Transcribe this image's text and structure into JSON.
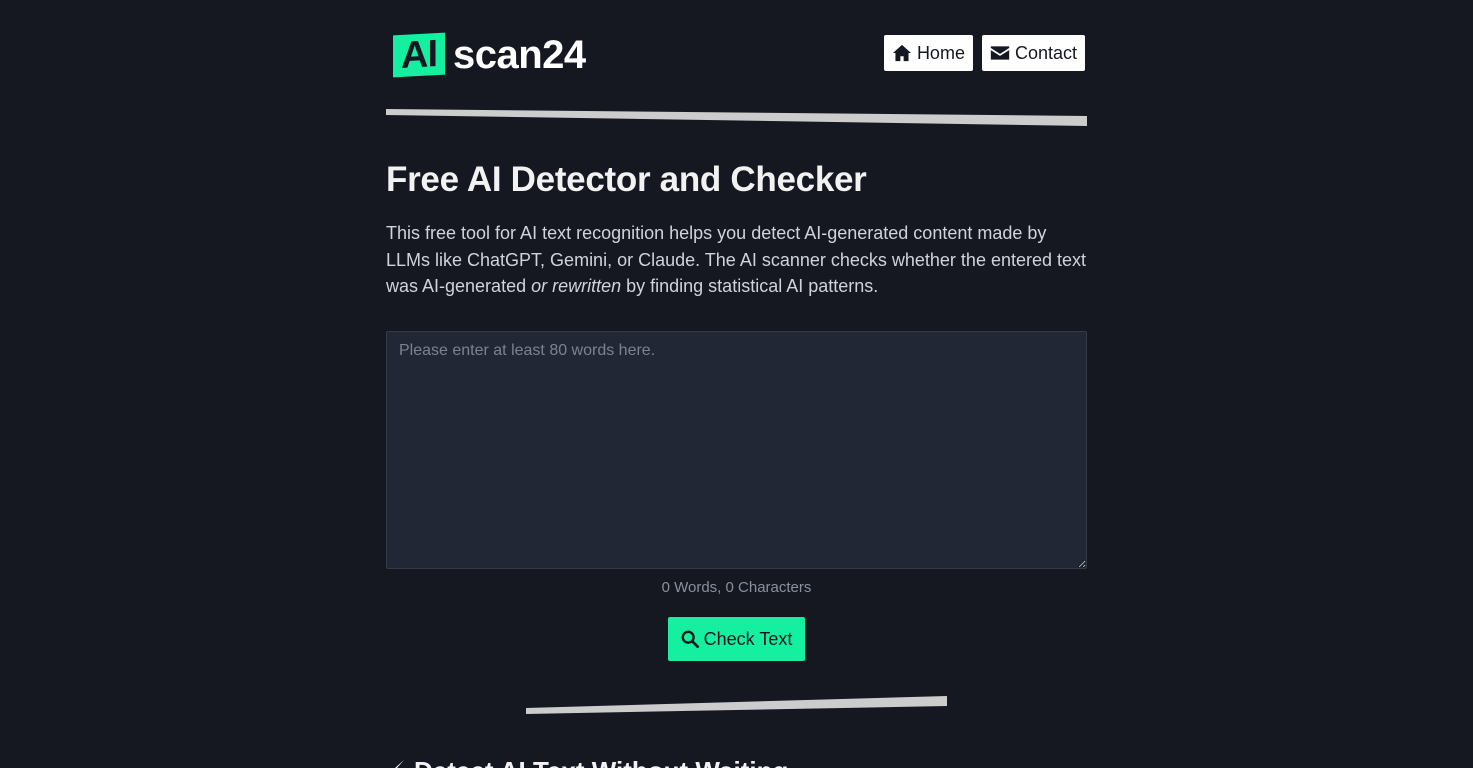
{
  "header": {
    "logo_mark": "AI",
    "logo_text": "scan24",
    "nav": [
      {
        "label": "Home",
        "icon": "home-icon"
      },
      {
        "label": "Contact",
        "icon": "envelope-icon"
      }
    ]
  },
  "main": {
    "title": "Free AI Detector and Checker",
    "intro_part1": "This free tool for AI text recognition helps you detect AI-generated content made by LLMs like ChatGPT, Gemini, or Claude. The AI scanner checks whether the entered text was AI-generated ",
    "intro_emphasis": "or rewritten",
    "intro_part2": " by finding statistical AI patterns.",
    "input": {
      "value": "",
      "placeholder": "Please enter at least 80 words here."
    },
    "counter": "0 Words, 0 Characters",
    "check_button_label": "Check Text",
    "next_section_title": "Detect AI Text Without Waiting"
  },
  "colors": {
    "background": "#151821",
    "accent": "#14f0a0",
    "input_background": "#212735",
    "divider": "#cccccc"
  }
}
